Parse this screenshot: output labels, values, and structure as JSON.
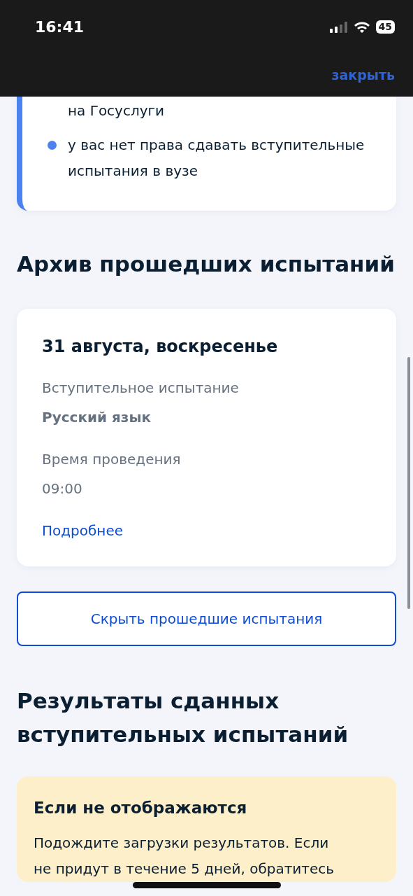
{
  "status_bar": {
    "time": "16:41",
    "battery": "45"
  },
  "header": {
    "close_label": "закрыть"
  },
  "notice": {
    "items": [
      {
        "kind": "continuation",
        "text": "на Госуслуги"
      },
      {
        "kind": "bullet",
        "text": "у вас нет права сдавать вступительные испытания в вузе"
      }
    ]
  },
  "archive": {
    "title": "Архив прошедших испытаний",
    "exams": [
      {
        "date": "31 августа, воскресенье",
        "fields": [
          {
            "label": "Вступительное испытание",
            "value": "Русский язык",
            "bold": true
          },
          {
            "label": "Время проведения",
            "value": "09:00",
            "bold": false
          }
        ],
        "link": "Подробнее"
      }
    ],
    "toggle_button": "Скрыть прошедшие испытания"
  },
  "results": {
    "title": "Результаты сданных вступительных испытаний",
    "alert": {
      "title": "Если не отображаются",
      "text": "Подождите загрузки результатов. Если не придут в течение 5 дней, обратитесь"
    }
  }
}
